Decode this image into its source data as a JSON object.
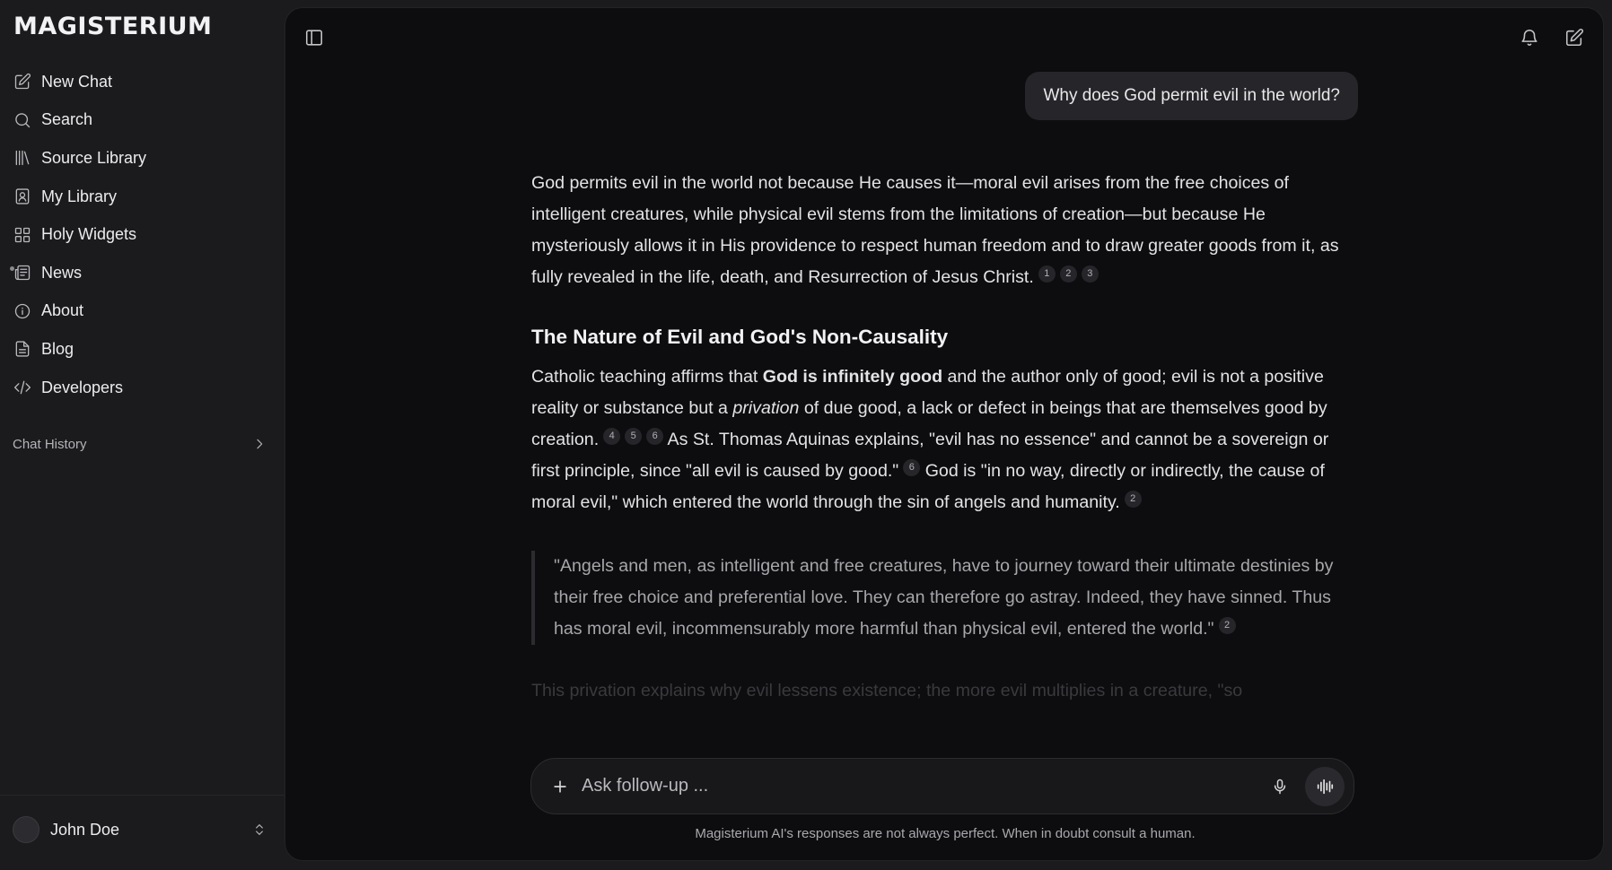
{
  "brand": "MAGISTERIUM",
  "nav": [
    {
      "label": "New Chat",
      "icon": "edit-icon"
    },
    {
      "label": "Search",
      "icon": "search-icon"
    },
    {
      "label": "Source Library",
      "icon": "library-icon"
    },
    {
      "label": "My Library",
      "icon": "contact-book-icon"
    },
    {
      "label": "Holy Widgets",
      "icon": "grid-icon"
    },
    {
      "label": "News",
      "icon": "newspaper-icon"
    },
    {
      "label": "About",
      "icon": "info-icon"
    },
    {
      "label": "Blog",
      "icon": "document-icon"
    },
    {
      "label": "Developers",
      "icon": "code-icon"
    }
  ],
  "chat_history_label": "Chat History",
  "user": {
    "name": "John Doe"
  },
  "conversation": {
    "question": "Why does God permit evil in the world?",
    "intro": {
      "text": "God permits evil in the world not because He causes it—moral evil arises from the free choices of intelligent creatures, while physical evil stems from the limitations of creation—but because He mysteriously allows it in His providence to respect human freedom and to draw greater goods from it, as fully revealed in the life, death, and Resurrection of Jesus Christ.",
      "cites": [
        "1",
        "2",
        "3"
      ]
    },
    "heading": "The Nature of Evil and God's Non-Causality",
    "para2": {
      "t1": "Catholic teaching affirms that ",
      "b1": "God is infinitely good",
      "t2": " and the author only of good; evil is not a positive reality or substance but a ",
      "i1": "privation",
      "t3": " of due good, a lack or defect in beings that are themselves good by creation.",
      "c1": [
        "4",
        "5",
        "6"
      ],
      "t4": " As St. Thomas Aquinas explains, \"evil has no essence\" and cannot be a sovereign or first principle, since \"all evil is caused by good.\"",
      "c2": "6",
      "t5": " God is \"in no way, directly or indirectly, the cause of moral evil,\" which entered the world through the sin of angels and humanity.",
      "c3": "2"
    },
    "quote": {
      "text": "\"Angels and men, as intelligent and free creatures, have to journey toward their ultimate destinies by their free choice and preferential love. They can therefore go astray. Indeed, they have sinned. Thus has moral evil, incommensurably more harmful than physical evil, entered the world.\"",
      "cite": "2"
    },
    "faded": "This privation explains why evil lessens existence; the more evil multiplies in a creature, \"so"
  },
  "composer": {
    "placeholder": "Ask follow-up ..."
  },
  "disclaimer": "Magisterium AI's responses are not always perfect. When in doubt consult a human."
}
